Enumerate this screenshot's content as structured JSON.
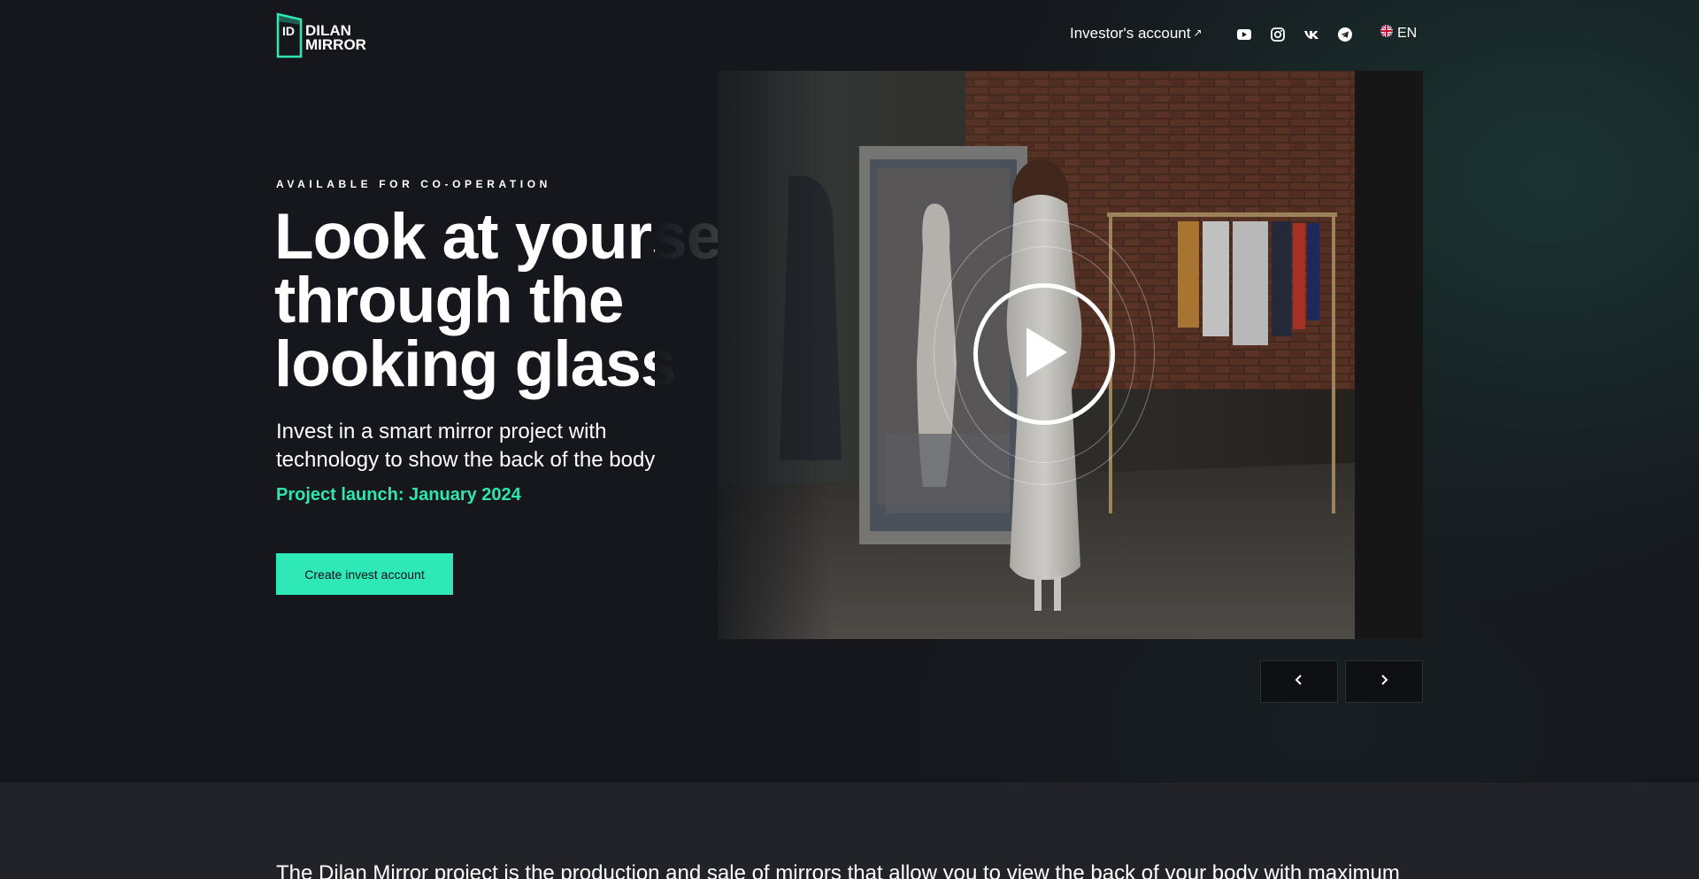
{
  "header": {
    "logo": {
      "line1": "DILAN",
      "line2": "MIRROR",
      "badge": "ID"
    },
    "investor_link": "Investor's account",
    "investor_link_icon": "external-arrow-icon",
    "socials": [
      {
        "name": "youtube-icon"
      },
      {
        "name": "instagram-icon"
      },
      {
        "name": "vk-icon"
      },
      {
        "name": "telegram-icon"
      }
    ],
    "language": "EN",
    "language_icon": "uk-flag-icon"
  },
  "hero": {
    "tagline": "AVAILABLE FOR CO-OPERATION",
    "headline": "Look at yourself through the looking glass",
    "subtitle": "Invest in a smart mirror project with technology to show the back of the body",
    "launch": "Project launch: January 2024",
    "cta_label": "Create invest account",
    "video_icon": "play-icon",
    "prev_icon": "chevron-left-icon",
    "next_icon": "chevron-right-icon"
  },
  "about": {
    "text": "The Dilan Mirror project is the production and sale of mirrors that allow you to view the back of your body with maximum"
  },
  "colors": {
    "accent": "#2ee8b6",
    "background": "#15171c",
    "section_bg": "#212328"
  }
}
